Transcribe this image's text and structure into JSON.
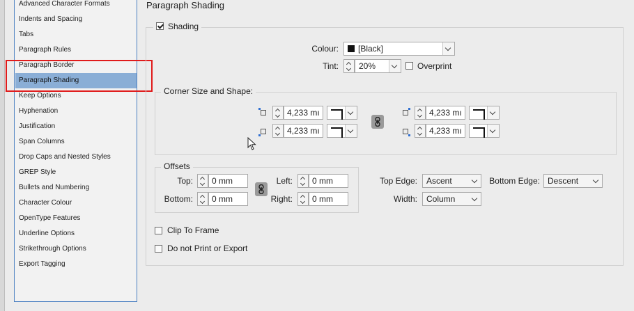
{
  "sidebar": {
    "items": [
      {
        "label": "Advanced Character Formats"
      },
      {
        "label": "Indents and Spacing"
      },
      {
        "label": "Tabs"
      },
      {
        "label": "Paragraph Rules"
      },
      {
        "label": "Paragraph Border"
      },
      {
        "label": "Paragraph Shading",
        "selected": true
      },
      {
        "label": "Keep Options"
      },
      {
        "label": "Hyphenation"
      },
      {
        "label": "Justification"
      },
      {
        "label": "Span Columns"
      },
      {
        "label": "Drop Caps and Nested Styles"
      },
      {
        "label": "GREP Style"
      },
      {
        "label": "Bullets and Numbering"
      },
      {
        "label": "Character Colour"
      },
      {
        "label": "OpenType Features"
      },
      {
        "label": "Underline Options"
      },
      {
        "label": "Strikethrough Options"
      },
      {
        "label": "Export Tagging"
      }
    ]
  },
  "page": {
    "title": "Paragraph Shading"
  },
  "shading": {
    "label": "Shading",
    "checked": true,
    "colour_label": "Colour:",
    "colour_value": "[Black]",
    "colour_swatch": "#111111",
    "tint_label": "Tint:",
    "tint_value": "20%",
    "overprint_label": "Overprint",
    "overprint_checked": false
  },
  "corners": {
    "title": "Corner Size and Shape:",
    "top_left": "4,233 mı",
    "bottom_left": "4,233 mı",
    "top_right": "4,233 mı",
    "bottom_right": "4,233 mı"
  },
  "offsets": {
    "title": "Offsets",
    "top_label": "Top:",
    "top_value": "0 mm",
    "bottom_label": "Bottom:",
    "bottom_value": "0 mm",
    "left_label": "Left:",
    "left_value": "0 mm",
    "right_label": "Right:",
    "right_value": "0 mm"
  },
  "edges": {
    "top_edge_label": "Top Edge:",
    "top_edge_value": "Ascent",
    "bottom_edge_label": "Bottom Edge:",
    "bottom_edge_value": "Descent",
    "width_label": "Width:",
    "width_value": "Column"
  },
  "options": {
    "clip_to_frame": "Clip To Frame",
    "do_not_print": "Do not Print or Export"
  },
  "colors": {
    "selection": "#8aaed6",
    "highlight": "#e01b1b",
    "list_border": "#4a7fc1"
  }
}
